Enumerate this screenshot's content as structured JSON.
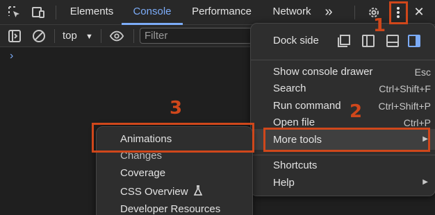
{
  "tabs": [
    {
      "label": "Elements"
    },
    {
      "label": "Console"
    },
    {
      "label": "Performance"
    },
    {
      "label": "Network"
    }
  ],
  "toolbar": {
    "more_tabs": "»",
    "close": "✕"
  },
  "console": {
    "context": "top",
    "filter_placeholder": "Filter",
    "prompt": "›"
  },
  "main_menu": {
    "dock_label": "Dock side",
    "items": [
      {
        "label": "Show console drawer",
        "shortcut": "Esc"
      },
      {
        "label": "Search",
        "shortcut": "Ctrl+Shift+F"
      },
      {
        "label": "Run command",
        "shortcut": "Ctrl+Shift+P"
      },
      {
        "label": "Open file",
        "shortcut": "Ctrl+P"
      },
      {
        "label": "More tools",
        "shortcut": "▶"
      },
      {
        "label": "Shortcuts",
        "shortcut": ""
      },
      {
        "label": "Help",
        "shortcut": "▶"
      }
    ]
  },
  "sub_menu": {
    "items": [
      {
        "label": "Animations"
      },
      {
        "label": "Changes"
      },
      {
        "label": "Coverage"
      },
      {
        "label": "CSS Overview"
      },
      {
        "label": "Developer Resources"
      }
    ]
  },
  "annotations": {
    "one": "1",
    "two": "2",
    "three": "3"
  },
  "colors": {
    "accent": "#7cacf8",
    "highlight": "#d0471b",
    "background": "#1f1f1f"
  }
}
